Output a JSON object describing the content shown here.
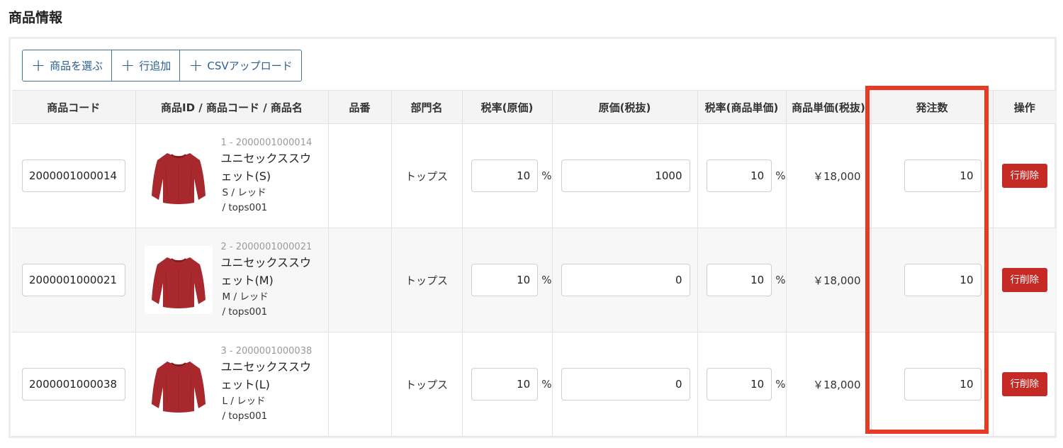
{
  "section_title": "商品情報",
  "toolbar": {
    "select_product": "商品を選ぶ",
    "add_row": "行追加",
    "csv_upload": "CSVアップロード"
  },
  "columns": [
    "商品コード",
    "商品ID / 商品コード / 商品名",
    "品番",
    "部門名",
    "税率(原価)",
    "原価(税抜)",
    "税率(商品単価)",
    "商品単価(税抜)",
    "発注数",
    "操作"
  ],
  "rows": [
    {
      "code": "2000001000014",
      "pid": "1 - 2000001000014",
      "name1": "ユニセックススウ",
      "name2": "ェット(S)",
      "variant1": "S / レッド",
      "variant2": "/ tops001",
      "part_no": "",
      "department": "トップス",
      "tax_cost": "10",
      "cost": "1000",
      "tax_price": "10",
      "unit_price": "￥18,000",
      "qty": "10",
      "delete_label": "行削除"
    },
    {
      "code": "2000001000021",
      "pid": "2 - 2000001000021",
      "name1": "ユニセックススウ",
      "name2": "ェット(M)",
      "variant1": "M / レッド",
      "variant2": "/ tops001",
      "part_no": "",
      "department": "トップス",
      "tax_cost": "10",
      "cost": "0",
      "tax_price": "10",
      "unit_price": "￥18,000",
      "qty": "10",
      "delete_label": "行削除"
    },
    {
      "code": "2000001000038",
      "pid": "3 - 2000001000038",
      "name1": "ユニセックススウ",
      "name2": "ェット(L)",
      "variant1": "L / レッド",
      "variant2": "/ tops001",
      "part_no": "",
      "department": "トップス",
      "tax_cost": "10",
      "cost": "0",
      "tax_price": "10",
      "unit_price": "￥18,000",
      "qty": "10",
      "delete_label": "行削除"
    }
  ],
  "percent_sign": "%",
  "colors": {
    "accent": "#2c5f91",
    "delete": "#c52a25",
    "highlight": "#e63a24",
    "sweater": "#a8282d"
  },
  "icons": {
    "plus": "plus-icon",
    "thumbnail": "sweater-thumbnail"
  }
}
